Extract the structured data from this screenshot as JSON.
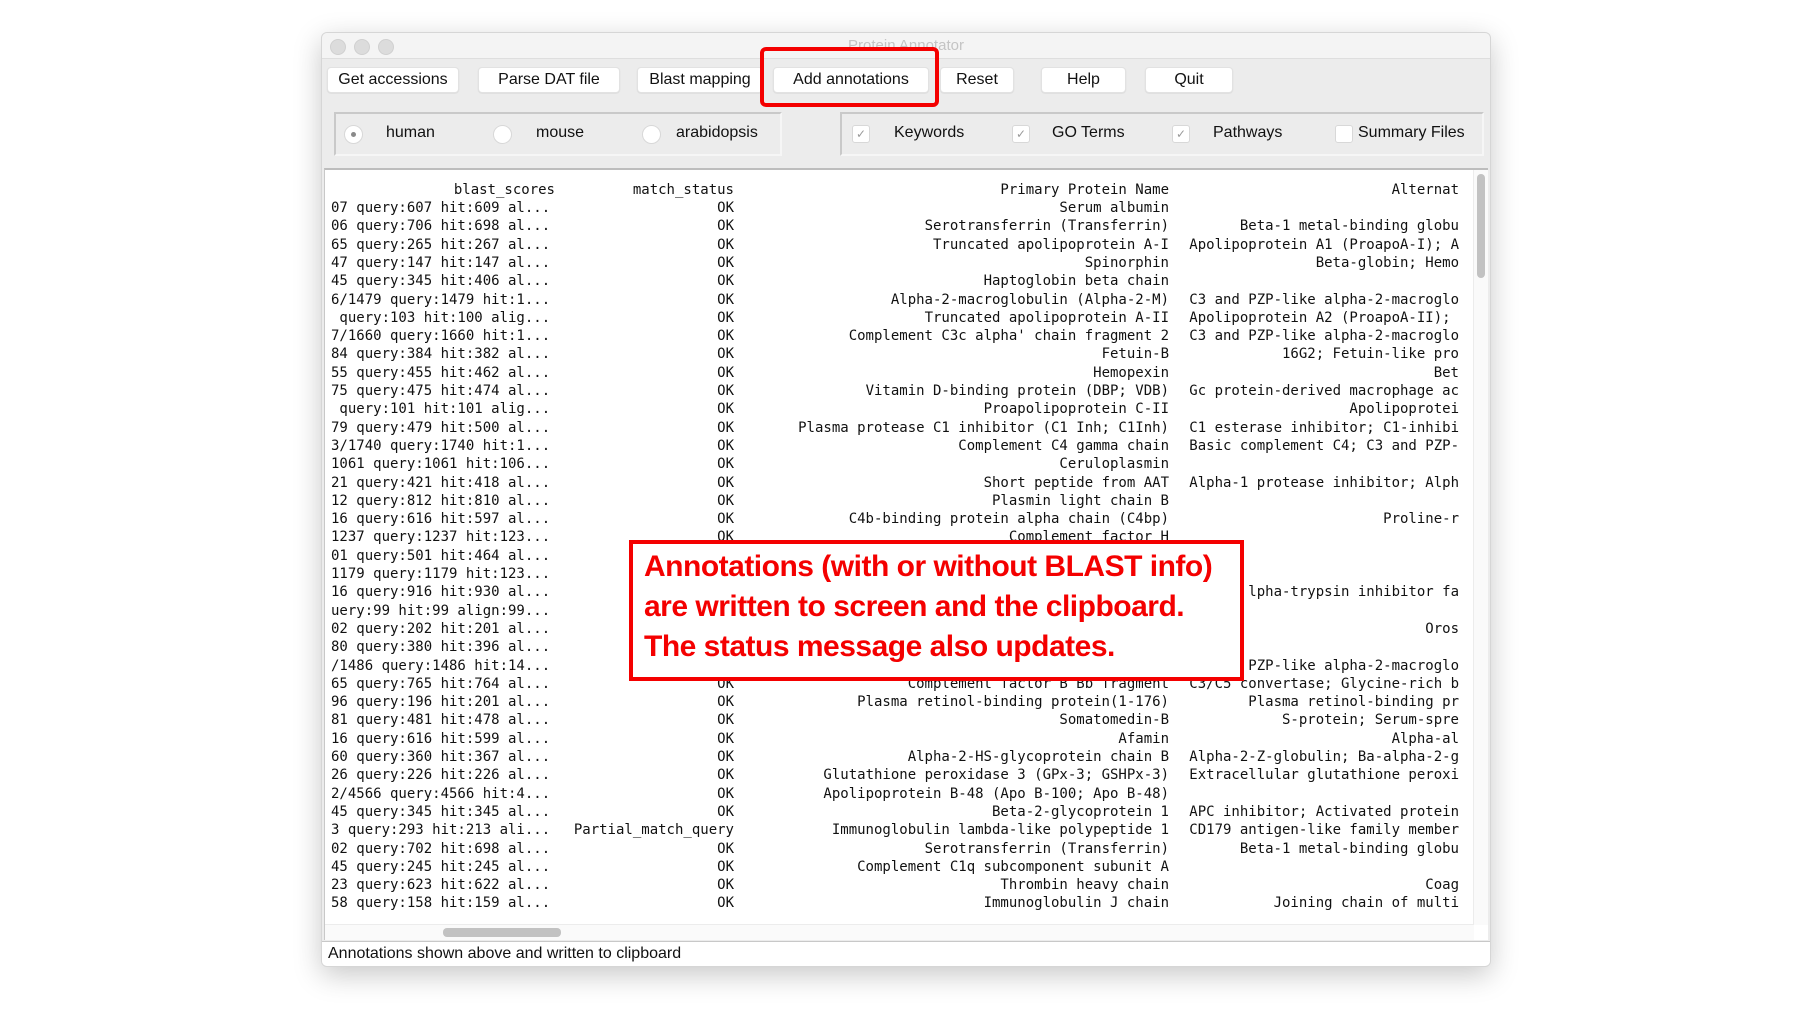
{
  "window": {
    "title": "Protein Annotator"
  },
  "toolbar": {
    "buttons": [
      "Get accessions",
      "Parse DAT file",
      "Blast mapping",
      "Add annotations",
      "Reset",
      "Help",
      "Quit"
    ],
    "highlighted": "Add annotations"
  },
  "species": {
    "options": [
      "human",
      "mouse",
      "arabidopsis"
    ],
    "selected": "human"
  },
  "outputs": {
    "options": [
      {
        "label": "Keywords",
        "checked": true
      },
      {
        "label": "GO Terms",
        "checked": true
      },
      {
        "label": "Pathways",
        "checked": true
      },
      {
        "label": "Summary Files",
        "checked": false
      }
    ]
  },
  "table": {
    "columns": [
      "blast_scores",
      "match_status",
      "Primary Protein Name",
      "Alternat"
    ],
    "rows": [
      [
        "07 query:607 hit:609 al...",
        "OK",
        "Serum albumin",
        ""
      ],
      [
        "06 query:706 hit:698 al...",
        "OK",
        "Serotransferrin (Transferrin)",
        "Beta-1 metal-binding globu"
      ],
      [
        "65 query:265 hit:267 al...",
        "OK",
        "Truncated apolipoprotein A-I",
        "Apolipoprotein A1 (ProapoA-I); A"
      ],
      [
        "47 query:147 hit:147 al...",
        "OK",
        "Spinorphin",
        "Beta-globin; Hemo"
      ],
      [
        "45 query:345 hit:406 al...",
        "OK",
        "Haptoglobin beta chain",
        ""
      ],
      [
        "6/1479 query:1479 hit:1...",
        "OK",
        "Alpha-2-macroglobulin (Alpha-2-M)",
        "C3 and PZP-like alpha-2-macroglo"
      ],
      [
        " query:103 hit:100 alig...",
        "OK",
        "Truncated apolipoprotein A-II",
        "Apolipoprotein A2 (ProapoA-II); "
      ],
      [
        "7/1660 query:1660 hit:1...",
        "OK",
        "Complement C3c alpha' chain fragment 2",
        "C3 and PZP-like alpha-2-macroglo"
      ],
      [
        "84 query:384 hit:382 al...",
        "OK",
        "Fetuin-B",
        "16G2; Fetuin-like pro"
      ],
      [
        "55 query:455 hit:462 al...",
        "OK",
        "Hemopexin",
        "Bet"
      ],
      [
        "75 query:475 hit:474 al...",
        "OK",
        "Vitamin D-binding protein (DBP; VDB)",
        "Gc protein-derived macrophage ac"
      ],
      [
        " query:101 hit:101 alig...",
        "OK",
        "Proapolipoprotein C-II",
        "Apolipoprotei"
      ],
      [
        "79 query:479 hit:500 al...",
        "OK",
        "Plasma protease C1 inhibitor (C1 Inh; C1Inh)",
        "C1 esterase inhibitor; C1-inhibi"
      ],
      [
        "3/1740 query:1740 hit:1...",
        "OK",
        "Complement C4 gamma chain",
        "Basic complement C4; C3 and PZP-"
      ],
      [
        "1061 query:1061 hit:106...",
        "OK",
        "Ceruloplasmin",
        ""
      ],
      [
        "21 query:421 hit:418 al...",
        "OK",
        "Short peptide from AAT",
        "Alpha-1 protease inhibitor; Alph"
      ],
      [
        "12 query:812 hit:810 al...",
        "OK",
        "Plasmin light chain B",
        ""
      ],
      [
        "16 query:616 hit:597 al...",
        "OK",
        "C4b-binding protein alpha chain (C4bp)",
        "Proline-r"
      ],
      [
        "1237 query:1237 hit:123...",
        "OK",
        "Complement factor H",
        ""
      ],
      [
        "01 query:501 hit:464 al...",
        "",
        "",
        ""
      ],
      [
        "1179 query:1179 hit:123...",
        "",
        "",
        ""
      ],
      [
        "16 query:916 hit:930 al...",
        "",
        "",
        "lpha-trypsin inhibitor fa"
      ],
      [
        "uery:99 hit:99 align:99...",
        "",
        "",
        ""
      ],
      [
        "02 query:202 hit:201 al...",
        "",
        "",
        "Oros"
      ],
      [
        "80 query:380 hit:396 al...",
        "",
        "",
        ""
      ],
      [
        "/1486 query:1486 hit:14...",
        "",
        "",
        "PZP-like alpha-2-macroglo"
      ],
      [
        "65 query:765 hit:764 al...",
        "OK",
        "Complement factor B Bb fragment",
        "C3/C5 convertase; Glycine-rich b"
      ],
      [
        "96 query:196 hit:201 al...",
        "OK",
        "Plasma retinol-binding protein(1-176)",
        "Plasma retinol-binding pr"
      ],
      [
        "81 query:481 hit:478 al...",
        "OK",
        "Somatomedin-B",
        "S-protein; Serum-spre"
      ],
      [
        "16 query:616 hit:599 al...",
        "OK",
        "Afamin",
        "Alpha-al"
      ],
      [
        "60 query:360 hit:367 al...",
        "OK",
        "Alpha-2-HS-glycoprotein chain B",
        "Alpha-2-Z-globulin; Ba-alpha-2-g"
      ],
      [
        "26 query:226 hit:226 al...",
        "OK",
        "Glutathione peroxidase 3 (GPx-3; GSHPx-3)",
        "Extracellular glutathione peroxi"
      ],
      [
        "2/4566 query:4566 hit:4...",
        "OK",
        "Apolipoprotein B-48 (Apo B-100; Apo B-48)",
        ""
      ],
      [
        "45 query:345 hit:345 al...",
        "OK",
        "Beta-2-glycoprotein 1",
        "APC inhibitor; Activated protein"
      ],
      [
        "3 query:293 hit:213 ali...",
        "Partial_match_query",
        "Immunoglobulin lambda-like polypeptide 1",
        "CD179 antigen-like family member"
      ],
      [
        "02 query:702 hit:698 al...",
        "OK",
        "Serotransferrin (Transferrin)",
        "Beta-1 metal-binding globu"
      ],
      [
        "45 query:245 hit:245 al...",
        "OK",
        "Complement C1q subcomponent subunit A",
        ""
      ],
      [
        "23 query:623 hit:622 al...",
        "OK",
        "Thrombin heavy chain",
        "Coag"
      ],
      [
        "58 query:158 hit:159 al...",
        "OK",
        "Immunoglobulin J chain",
        "Joining chain of multi"
      ]
    ]
  },
  "status_bar": {
    "message": "Annotations shown above and written to clipboard"
  },
  "callout": {
    "lines": [
      "Annotations (with or without BLAST info)",
      "are written to screen and the clipboard.",
      "The status message also updates."
    ],
    "color": "#f40000"
  }
}
